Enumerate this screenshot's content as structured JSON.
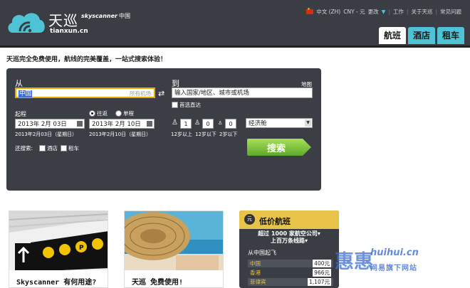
{
  "brand": {
    "name_cn": "天巡",
    "skyscanner": "skyscanner",
    "skyscanner_cn": "中国",
    "url": "tianxun.cn"
  },
  "topbar": {
    "lang": "中文 (ZH)",
    "currency": "CNY - 元",
    "change": "更改",
    "jobs": "工作",
    "about": "关于天巡",
    "faq": "常见问题"
  },
  "tabs": [
    {
      "label": "航班"
    },
    {
      "label": "酒店"
    },
    {
      "label": "租车"
    }
  ],
  "tagline": "天巡完全免费使用，航线的完美覆盖，一站式搜索体验！",
  "search": {
    "from_label": "从",
    "from_value": "中国",
    "from_hint": "所有机场",
    "to_label": "到",
    "to_placeholder": "输入国家/地区、城市或机场",
    "map_link": "地图",
    "direct_only": "首选直达",
    "depart_label": "起程",
    "roundtrip": "往返",
    "oneway": "单程",
    "depart_date": "2013年 2月 03日",
    "depart_sub": "2013年2月03日（星期日）",
    "return_date": "2013年 2月 10日",
    "return_sub": "2013年2月10日（星期日）",
    "adults": "1",
    "children": "0",
    "infants": "0",
    "adults_label": "12岁以上",
    "children_label": "12岁以下",
    "infants_label": "2岁以下",
    "cabin": "经济舱",
    "also_search": "还搜索:",
    "hotel": "酒店",
    "car": "租车",
    "button": "搜索"
  },
  "cards": [
    {
      "caption": "Skyscanner 有何用途?"
    },
    {
      "caption": "天巡 免费使用!"
    }
  ],
  "deals": {
    "badge": "元",
    "title": "低价航班",
    "sub1": "超过 1000 家航空公司▾",
    "sub2": "上百万条线路▾",
    "from": "从中国起飞",
    "rows": [
      {
        "dest": "中国",
        "price": "400元"
      },
      {
        "dest": "香港",
        "price": "966元"
      },
      {
        "dest": "菲律宾",
        "price": "1,107元"
      }
    ]
  },
  "watermark": {
    "logo": "惠惠",
    "url": "huihui.cn",
    "sub": "网易旗下网站"
  },
  "colors": {
    "header": "#3a3d43",
    "tab": "#4fc3d6",
    "search_green": "#7dc33b",
    "deal_yellow": "#e7c34a"
  }
}
